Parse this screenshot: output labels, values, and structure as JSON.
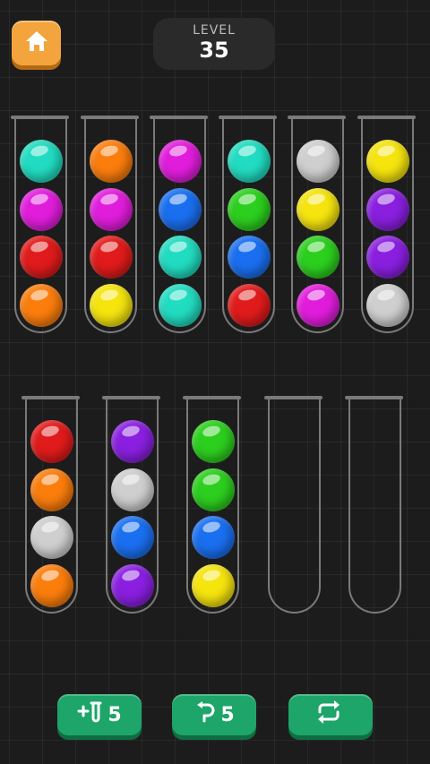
{
  "header": {
    "level_label": "LEVEL",
    "level_number": "35"
  },
  "colors": {
    "cyan": "#21dcc1",
    "magenta": "#e11ddc",
    "red": "#e11b1b",
    "orange": "#fb7d0c",
    "yellow": "#f5e40e",
    "blue": "#1a6ff0",
    "green": "#2ccf1e",
    "silver": "#cfcfcf",
    "purple": "#8a1fe0"
  },
  "tubes": [
    [
      "cyan",
      "magenta",
      "red",
      "orange"
    ],
    [
      "orange",
      "magenta",
      "red",
      "yellow"
    ],
    [
      "magenta",
      "blue",
      "cyan",
      "cyan"
    ],
    [
      "cyan",
      "green",
      "blue",
      "red"
    ],
    [
      "silver",
      "yellow",
      "green",
      "magenta"
    ],
    [
      "yellow",
      "purple",
      "purple",
      "silver"
    ],
    [
      "red",
      "orange",
      "silver",
      "orange"
    ],
    [
      "purple",
      "silver",
      "blue",
      "purple"
    ],
    [
      "green",
      "green",
      "blue",
      "yellow"
    ],
    [],
    []
  ],
  "buttons": {
    "add_tube_count": "5",
    "undo_count": "5"
  },
  "icons": {
    "home": "home-icon",
    "add_tube": "add-tube-icon",
    "undo": "undo-icon",
    "restart": "restart-icon"
  }
}
